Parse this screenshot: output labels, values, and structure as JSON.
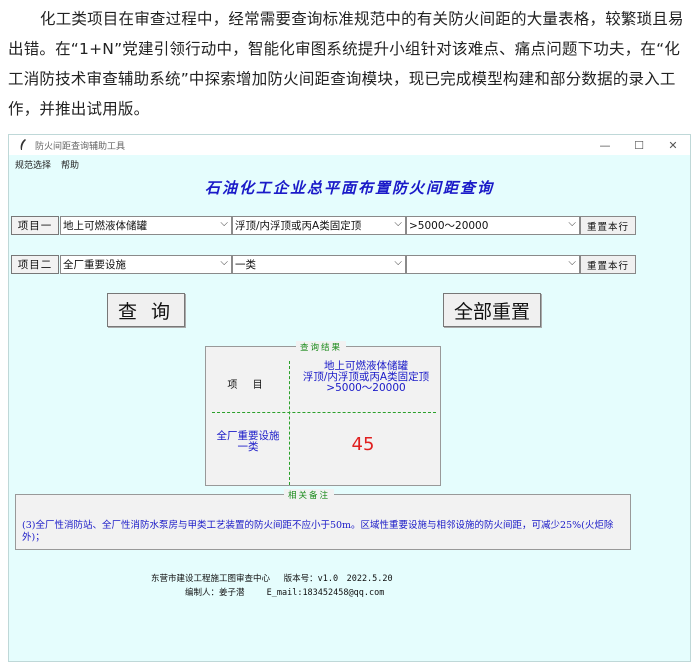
{
  "article": {
    "text": "化工类项目在审查过程中，经常需要查询标准规范中的有关防火间距的大量表格，较繁琐且易出错。在“1+N”党建引领行动中，智能化审图系统提升小组针对该难点、痛点问题下功夫，在“化工消防技术审查辅助系统”中探索增加防火间距查询模块，现已完成模型构建和部分数据的录入工作，并推出试用版。"
  },
  "window": {
    "title": "防火间距查询辅助工具",
    "icon": "feather-icon",
    "controls": {
      "minimize": "—",
      "maximize": "☐",
      "close": "✕"
    }
  },
  "menu": {
    "items": [
      "规范选择",
      "帮助"
    ]
  },
  "app": {
    "title": "石油化工企业总平面布置防火间距查询"
  },
  "item1": {
    "label": "项目一",
    "select1": "地上可燃液体储罐",
    "select2": "浮顶/内浮顶或丙A类固定顶",
    "select3": ">5000～20000",
    "reset_label": "重置本行"
  },
  "item2": {
    "label": "项目二",
    "select1": "全厂重要设施",
    "select2": "一类",
    "select3": "",
    "reset_label": "重置本行"
  },
  "buttons": {
    "query": "查 询",
    "reset_all": "全部重置"
  },
  "result": {
    "caption": "查询结果",
    "header_label": "项 目",
    "col_line1": "地上可燃液体储罐",
    "col_line2": "浮顶/内浮顶或丙A类固定顶",
    "col_line3": ">5000～20000",
    "row_line1": "全厂重要设施",
    "row_line2": "一类",
    "value": "45"
  },
  "notes": {
    "caption": "相关备注",
    "text": "(3)全厂性消防站、全厂性消防水泵房与甲类工艺装置的防火间距不应小于50m。区域性重要设施与相邻设施的防火间距，可减少25%(火炬除外)；"
  },
  "footer": {
    "line1": "东营市建设工程施工图审查中心　 版本号：v1.0　2022.5.20",
    "line2": "编制人：姜子潜　　 E_mail:183452458@qq.com"
  },
  "colors": {
    "accent_blue": "#1a1ac8",
    "green": "#1a8a1a",
    "value_red": "#e02020",
    "window_bg": "#e5fdfd"
  }
}
